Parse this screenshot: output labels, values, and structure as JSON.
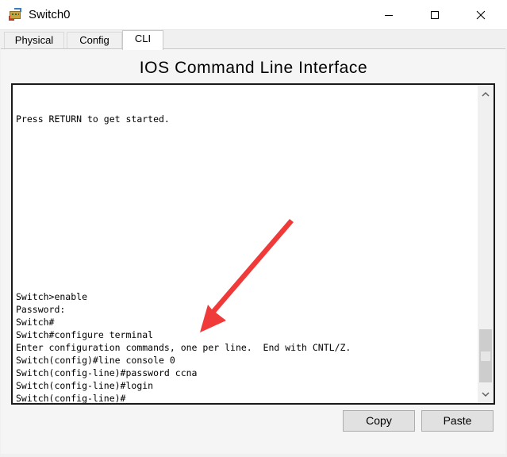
{
  "window": {
    "title": "Switch0"
  },
  "tabs": [
    {
      "label": "Physical",
      "active": false
    },
    {
      "label": "Config",
      "active": false
    },
    {
      "label": "CLI",
      "active": true
    }
  ],
  "cli": {
    "heading": "IOS Command Line Interface",
    "lines": [
      "Press RETURN to get started.",
      "Switch>enable",
      "Password:",
      "Switch#",
      "Switch#configure terminal",
      "Enter configuration commands, one per line.  End with CNTL/Z.",
      "Switch(config)#line console 0",
      "Switch(config-line)#password ccna",
      "Switch(config-line)#login",
      "Switch(config-line)#"
    ]
  },
  "buttons": {
    "copy": "Copy",
    "paste": "Paste"
  },
  "annotation": {
    "arrow_color": "#f03a3a"
  }
}
